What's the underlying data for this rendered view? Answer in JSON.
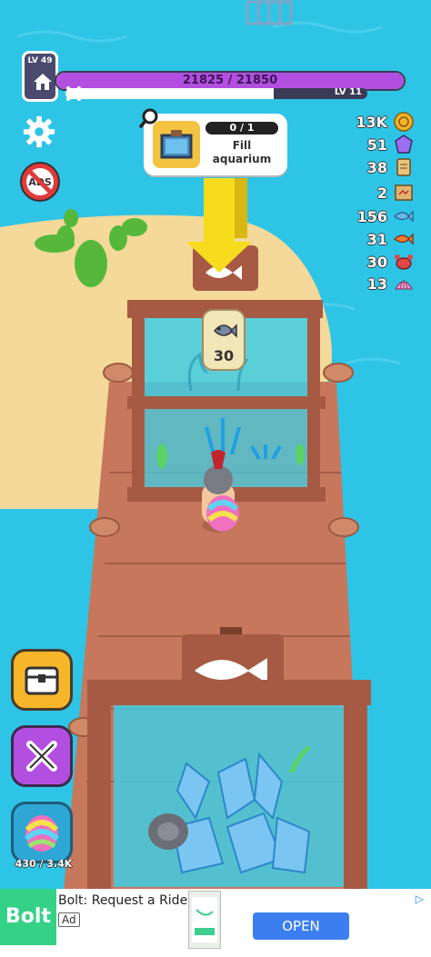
{
  "player": {
    "level_label": "LV 49",
    "xp_text": "21825 / 21850",
    "xp_progress": 0.999,
    "sub_level_label": "LV 11",
    "sub_progress": 0.69
  },
  "quest": {
    "progress_text": "0 / 1",
    "label": "Fill\naquarium"
  },
  "resources": [
    {
      "value": "13K",
      "icon": "coin-icon",
      "color": "#f3b42b"
    },
    {
      "value": "51",
      "icon": "gem-icon",
      "color": "#9c6ff0"
    },
    {
      "value": "38",
      "icon": "scroll-icon",
      "color": "#e8c47c"
    },
    {
      "value": "2",
      "icon": "map-icon",
      "color": "#e0b46e"
    },
    {
      "value": "156",
      "icon": "blue-fish-icon",
      "color": "#6bb8ea"
    },
    {
      "value": "31",
      "icon": "orange-fish-icon",
      "color": "#f27a37"
    },
    {
      "value": "30",
      "icon": "crab-icon",
      "color": "#e0474a"
    },
    {
      "value": "13",
      "icon": "shell-icon",
      "color": "#f1a6d6"
    }
  ],
  "tank_requirement": {
    "count": "30",
    "icon": "fish-icon"
  },
  "gem_inventory": "430 / 3.4K",
  "ad": {
    "logo_text": "Bolt",
    "title": "Bolt: Request a Ride",
    "ad_tag": "Ad",
    "open_button": "OPEN",
    "choice_icon": "adchoices-icon"
  },
  "colors": {
    "water": "#2ec4e6",
    "sand": "#f4d99a",
    "deck": "#c7775c",
    "xp": "#b24fe0"
  }
}
